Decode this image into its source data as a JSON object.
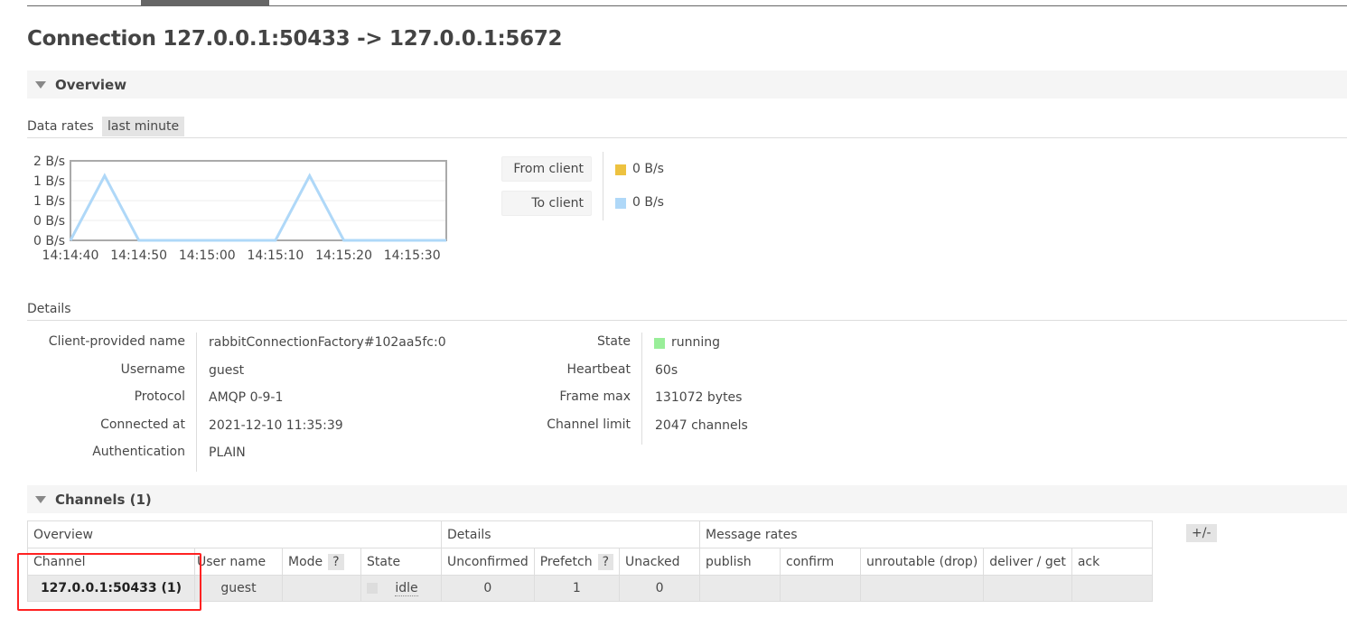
{
  "title": "Connection 127.0.0.1:50433 -> 127.0.0.1:5672",
  "overview": {
    "section_label": "Overview",
    "data_rates_label": "Data rates",
    "range": "last minute",
    "legend": [
      {
        "label": "From client",
        "value": "0 B/s",
        "color": "#edc240"
      },
      {
        "label": "To client",
        "value": "0 B/s",
        "color": "#afd8f8"
      }
    ]
  },
  "chart_data": {
    "type": "line",
    "x_ticks": [
      "14:14:40",
      "14:14:50",
      "14:15:00",
      "14:15:10",
      "14:15:20",
      "14:15:30"
    ],
    "y_ticks": [
      "2 B/s",
      "1 B/s",
      "1 B/s",
      "0 B/s",
      "0 B/s"
    ],
    "ylim": [
      0,
      1.6
    ],
    "grid": true,
    "series": [
      {
        "name": "To client",
        "color": "#afd8f8",
        "x": [
          "14:14:40",
          "14:14:45",
          "14:14:50",
          "14:15:10",
          "14:15:15",
          "14:15:20",
          "14:15:35"
        ],
        "values": [
          0,
          1.3,
          0,
          0,
          1.3,
          0,
          0
        ]
      }
    ]
  },
  "details": {
    "section_label": "Details",
    "left": [
      {
        "label": "Client-provided name",
        "value": "rabbitConnectionFactory#102aa5fc:0"
      },
      {
        "label": "Username",
        "value": "guest"
      },
      {
        "label": "Protocol",
        "value": "AMQP 0-9-1"
      },
      {
        "label": "Connected at",
        "value": "2021-12-10 11:35:39"
      },
      {
        "label": "Authentication",
        "value": "PLAIN"
      }
    ],
    "right": [
      {
        "label": "State",
        "value": "running"
      },
      {
        "label": "Heartbeat",
        "value": "60s"
      },
      {
        "label": "Frame max",
        "value": "131072 bytes"
      },
      {
        "label": "Channel limit",
        "value": "2047 channels"
      }
    ],
    "state_color": "#99ee99"
  },
  "channels": {
    "section_label": "Channels (1)",
    "plus_minus": "+/-",
    "groups": [
      "Overview",
      "Details",
      "Message rates"
    ],
    "columns": [
      "Channel",
      "User name",
      "Mode",
      "State",
      "Unconfirmed",
      "Prefetch",
      "Unacked",
      "publish",
      "confirm",
      "unroutable (drop)",
      "deliver / get",
      "ack"
    ],
    "help": "?",
    "rows": [
      {
        "channel": "127.0.0.1:50433 (1)",
        "user": "guest",
        "mode": "",
        "state": "idle",
        "unconfirmed": "0",
        "prefetch": "1",
        "unacked": "0",
        "publish": "",
        "confirm": "",
        "unroutable": "",
        "deliver": "",
        "ack": ""
      }
    ]
  }
}
